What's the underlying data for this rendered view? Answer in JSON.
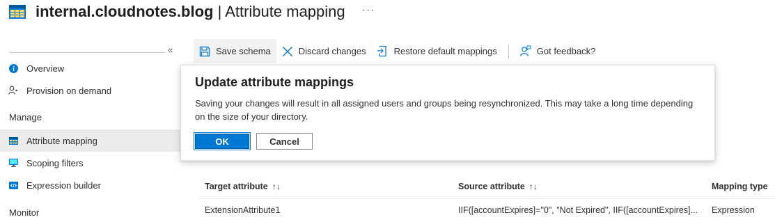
{
  "header": {
    "app_name": "internal.cloudnotes.blog",
    "separator": " | ",
    "page_title": "Attribute mapping",
    "more": "···"
  },
  "sidebar": {
    "collapse": "«",
    "items": [
      {
        "label": "Overview",
        "icon": "info-icon"
      },
      {
        "label": "Provision on demand",
        "icon": "user-sync-icon"
      }
    ],
    "manage_heading": "Manage",
    "manage_items": [
      {
        "label": "Attribute mapping",
        "icon": "table-icon",
        "active": true
      },
      {
        "label": "Scoping filters",
        "icon": "monitor-icon"
      },
      {
        "label": "Expression builder",
        "icon": "code-icon"
      }
    ],
    "monitor_heading": "Monitor"
  },
  "toolbar": {
    "save": "Save schema",
    "discard": "Discard changes",
    "restore": "Restore default mappings",
    "feedback": "Got feedback?"
  },
  "dialog": {
    "title": "Update attribute mappings",
    "body": "Saving your changes will result in all assigned users and groups being resynchronized. This may take a long time depending on the size of your directory.",
    "ok": "OK",
    "cancel": "Cancel"
  },
  "table": {
    "columns": [
      "Target attribute",
      "Source attribute",
      "Mapping type"
    ],
    "sort_glyph": "↑↓",
    "rows": [
      [
        "ExtensionAttribute1",
        "IIF([accountExpires]=\"0\", \"Not Expired\", IIF([accountExpires]...",
        "Expression"
      ]
    ]
  },
  "colors": {
    "accent": "#0078d4",
    "active_nav": "#edebe9"
  }
}
